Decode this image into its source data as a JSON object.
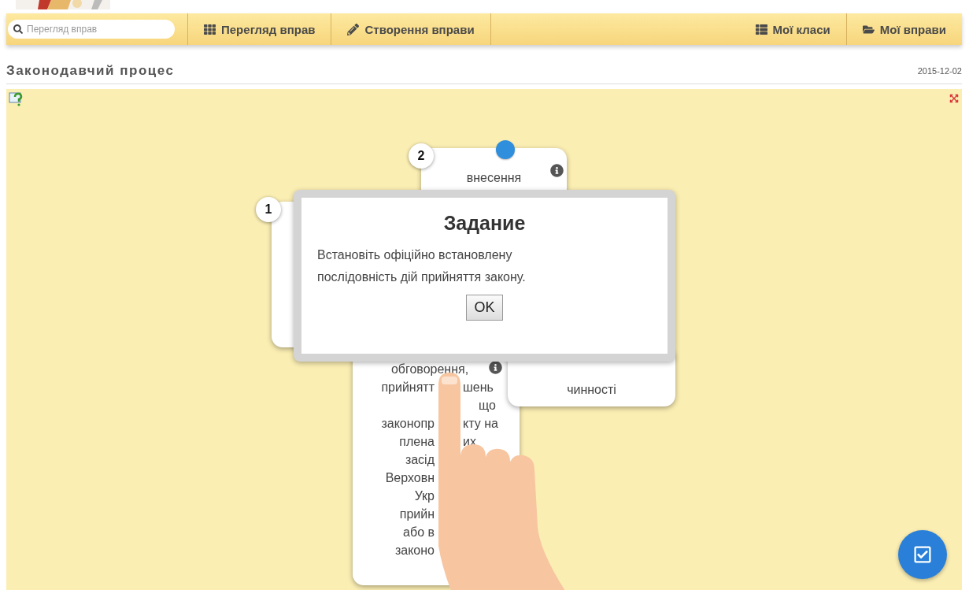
{
  "toolbar": {
    "search": {
      "placeholder": "Перегляд вправ"
    },
    "nav_left": [
      {
        "label": "Перегляд вправ",
        "kind": "grid"
      },
      {
        "label": "Створення вправи",
        "kind": "pencil"
      }
    ],
    "nav_right": [
      {
        "label": "Мої класи",
        "kind": "list"
      },
      {
        "label": "Мої вправи",
        "kind": "folder"
      }
    ]
  },
  "title": "Законодавчий процес",
  "date": "2015-12-02",
  "cards": [
    {
      "number": "1"
    },
    {
      "number": "2",
      "pin": true,
      "info": true,
      "lines": [
        [
          "внесення"
        ]
      ]
    },
    {
      "info": true,
      "lines": [
        [
          "обговорення,"
        ],
        [
          "прийнятт",
          "шень"
        ],
        [
          "що"
        ],
        [
          "законопр",
          "кту на"
        ],
        [
          "плена",
          "их"
        ],
        [
          "засід"
        ],
        [
          "Верховн"
        ],
        [
          "Укр"
        ],
        [
          "прийн"
        ],
        [
          "або в"
        ],
        [
          "законо"
        ]
      ]
    },
    {
      "lines": [
        [
          "чинності"
        ]
      ]
    }
  ],
  "dialog": {
    "title": "Задание",
    "text": "Встановіть офіційно встановлену послідовність дій прийняття закону.",
    "button": "OK"
  }
}
